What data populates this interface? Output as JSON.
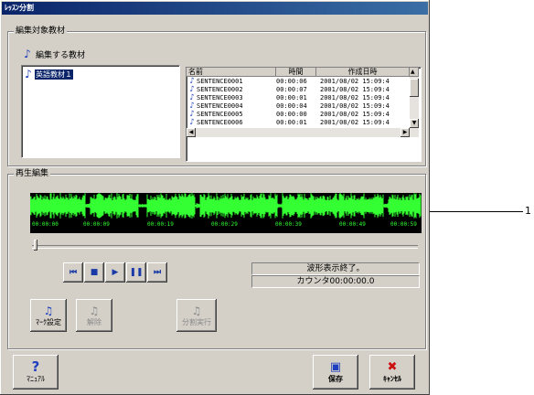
{
  "window": {
    "title": "ﾚｯｽﾝ分割"
  },
  "target_group": {
    "title": "編集対象教材",
    "label": "編集する教材",
    "selected_material": "英語教材１"
  },
  "list": {
    "columns": [
      "名前",
      "時間",
      "作成日時"
    ],
    "rows": [
      [
        "SENTENCE0001",
        "00:00:06",
        "2001/08/02 15:09:4"
      ],
      [
        "SENTENCE0002",
        "00:00:07",
        "2001/08/02 15:09:4"
      ],
      [
        "SENTENCE0003",
        "00:00:01",
        "2001/08/02 15:09:4"
      ],
      [
        "SENTENCE0004",
        "00:00:04",
        "2001/08/02 15:09:4"
      ],
      [
        "SENTENCE0005",
        "00:00:00",
        "2001/08/02 15:09:4"
      ],
      [
        "SENTENCE0006",
        "00:00:01",
        "2001/08/02 15:09:4"
      ]
    ]
  },
  "playback_group": {
    "title": "再生編集",
    "time_ticks": [
      "00:00:00",
      "00:00:09",
      "00:00:19",
      "00:00:29",
      "00:00:39",
      "00:00:49",
      "00:00:59"
    ],
    "status_message": "波形表示終了。",
    "counter": "カウンタ00:00:00.0"
  },
  "edit_buttons": {
    "mark": "ﾏｰｸ設定",
    "release": "解除",
    "split": "分割実行"
  },
  "bottom_buttons": {
    "manual": "ﾏﾆｭｱﾙ",
    "save": "保存",
    "cancel": "ｷｬﾝｾﾙ"
  },
  "callout": {
    "number": "1"
  },
  "colors": {
    "waveform": "#33ff33",
    "title_bar": "#0a246a",
    "icon_blue": "#1e3fbf"
  }
}
